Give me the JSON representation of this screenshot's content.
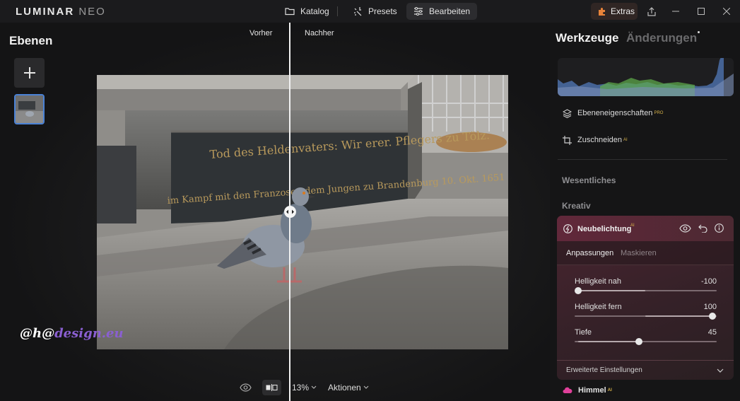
{
  "app": {
    "name": "LUMINAR",
    "name_suffix": "NEO"
  },
  "nav": {
    "katalog": "Katalog",
    "presets": "Presets",
    "bearbeiten": "Bearbeiten",
    "extras": "Extras"
  },
  "left": {
    "title": "Ebenen"
  },
  "canvas": {
    "before": "Vorher",
    "after": "Nachher",
    "watermark_prefix": "@h@",
    "watermark_domain": "design.eu",
    "photo_inscription_1": "Tod des Heldenvaters: Wir erer. Pflegers zu Tölz.",
    "photo_inscription_2": "im Kampf mit den Franzosen dem Jungen zu Brandenburg 10. Okt. 1651"
  },
  "bottom": {
    "zoom": "13%",
    "actions": "Aktionen"
  },
  "right": {
    "tab_tools": "Werkzeuge",
    "tab_changes": "Änderungen",
    "layer_props": "Ebeneneigenschaften",
    "layer_props_badge": "PRO",
    "crop": "Zuschneiden",
    "ai_badge": "AI",
    "section_essentials": "Wesentliches",
    "section_creative": "Kreativ",
    "tool": {
      "title": "Neubelichtung",
      "tab_adjust": "Anpassungen",
      "tab_mask": "Maskieren",
      "sliders": [
        {
          "label": "Helligkeit nah",
          "value": -100,
          "value_text": "-100"
        },
        {
          "label": "Helligkeit fern",
          "value": 100,
          "value_text": "100"
        },
        {
          "label": "Tiefe",
          "value": 45,
          "value_text": "45"
        }
      ],
      "advanced": "Erweiterte Einstellungen"
    },
    "next_tool": "Himmel"
  },
  "colors": {
    "accent_active": "#4a82d6",
    "tool_card": "#4a2530",
    "ai_badge": "#d8b24a",
    "sky_icon": "#e0409a"
  }
}
